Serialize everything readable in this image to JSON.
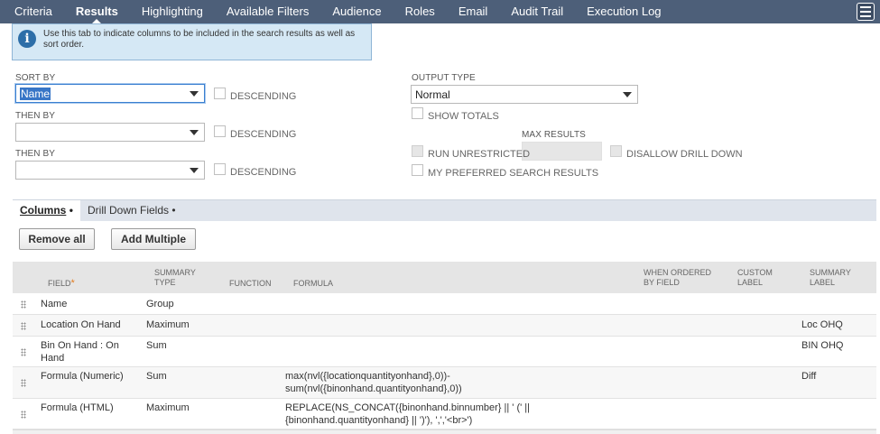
{
  "nav": {
    "tabs": [
      {
        "label": "Criteria"
      },
      {
        "label": "Results"
      },
      {
        "label": "Highlighting"
      },
      {
        "label": "Available Filters"
      },
      {
        "label": "Audience"
      },
      {
        "label": "Roles"
      },
      {
        "label": "Email"
      },
      {
        "label": "Audit Trail"
      },
      {
        "label": "Execution Log"
      }
    ],
    "active": "Results",
    "menu_icon": "hamburger-icon"
  },
  "info": {
    "icon": "info-icon",
    "icon_glyph": "i",
    "text": "Use this tab to indicate columns to be included in the search results as well as sort order."
  },
  "sort": {
    "sort_by_label": "SORT BY",
    "sort_by_value": "Name",
    "then_by_label_1": "THEN BY",
    "then_by_value_1": "",
    "then_by_label_2": "THEN BY",
    "then_by_value_2": "",
    "descending_label": "DESCENDING"
  },
  "output": {
    "output_type_label": "OUTPUT TYPE",
    "output_type_value": "Normal",
    "show_totals_label": "SHOW TOTALS",
    "max_results_label": "MAX RESULTS",
    "run_unrestricted_label": "RUN UNRESTRICTED",
    "disallow_drill_down_label": "DISALLOW DRILL DOWN",
    "my_preferred_label": "MY PREFERRED SEARCH RESULTS"
  },
  "subtabs": {
    "columns_label": "Columns",
    "drill_down_label": "Drill Down Fields",
    "bullet": "•"
  },
  "buttons": {
    "remove_all": "Remove all",
    "add_multiple": "Add Multiple"
  },
  "table": {
    "headers": {
      "field": "FIELD",
      "required_marker": "*",
      "summary_type_1": "SUMMARY",
      "summary_type_2": "TYPE",
      "function": "FUNCTION",
      "formula": "FORMULA",
      "when_ordered_1": "WHEN ORDERED",
      "when_ordered_2": "BY FIELD",
      "custom_label_1": "CUSTOM",
      "custom_label_2": "LABEL",
      "summary_label_1": "SUMMARY",
      "summary_label_2": "LABEL"
    },
    "rows": [
      {
        "field_1": "Name",
        "field_2": "",
        "summary_type": "Group",
        "formula_1": "",
        "formula_2": "",
        "summary_label": ""
      },
      {
        "field_1": "Location On Hand",
        "field_2": "",
        "summary_type": "Maximum",
        "formula_1": "",
        "formula_2": "",
        "summary_label": "Loc OHQ"
      },
      {
        "field_1": "Bin On Hand : On",
        "field_2": "Hand",
        "summary_type": "Sum",
        "formula_1": "",
        "formula_2": "",
        "summary_label": "BIN OHQ"
      },
      {
        "field_1": "Formula (Numeric)",
        "field_2": "",
        "summary_type": "Sum",
        "formula_1": "max(nvl({locationquantityonhand},0))-",
        "formula_2": "sum(nvl({binonhand.quantityonhand},0))",
        "summary_label": "Diff"
      },
      {
        "field_1": "Formula (HTML)",
        "field_2": "",
        "summary_type": "Maximum",
        "formula_1": "REPLACE(NS_CONCAT({binonhand.binnumber} || ' (' ||",
        "formula_2": "{binonhand.quantityonhand} || ')'), ',','<br>')",
        "summary_label": ""
      }
    ]
  }
}
